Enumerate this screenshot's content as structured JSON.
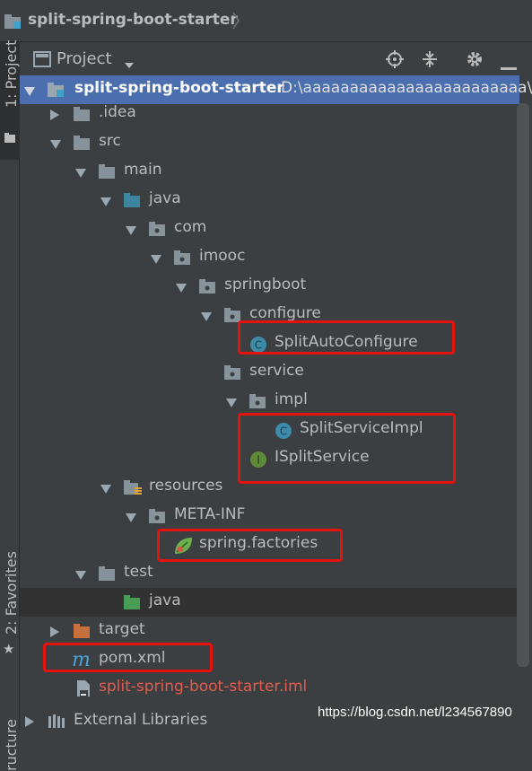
{
  "breadcrumb": {
    "title": "split-spring-boot-starter"
  },
  "panel": {
    "title": "Project"
  },
  "left_strip": {
    "project_tab": "1: Project",
    "favorites_tab": "2: Favorites",
    "structure_tab": "ructure"
  },
  "tree": {
    "root_name": "split-spring-boot-starter",
    "root_path": "D:\\aaaaaaaaaaaaaaaaaaaaaaaa\\sp",
    "idea": ".idea",
    "src": "src",
    "main": "main",
    "java": "java",
    "com": "com",
    "imooc": "imooc",
    "springboot": "springboot",
    "configure": "configure",
    "split_auto_configure": "SplitAutoConfigure",
    "service": "service",
    "impl": "impl",
    "split_service_impl": "SplitServiceImpl",
    "isplit_service": "ISplitService",
    "resources": "resources",
    "meta_inf": "META-INF",
    "spring_factories": "spring.factories",
    "test": "test",
    "test_java": "java",
    "target": "target",
    "pom": "pom.xml",
    "iml": "split-spring-boot-starter.iml",
    "external_libraries": "External Libraries"
  },
  "watermark": "https://blog.csdn.net/l234567890",
  "colors": {
    "selection": "#4b6eaf",
    "highlight_box": "#e5120c",
    "folder": "#87939a",
    "source_folder": "#3e86a0",
    "test_folder": "#499c54",
    "excluded_folder": "#c7703d"
  }
}
